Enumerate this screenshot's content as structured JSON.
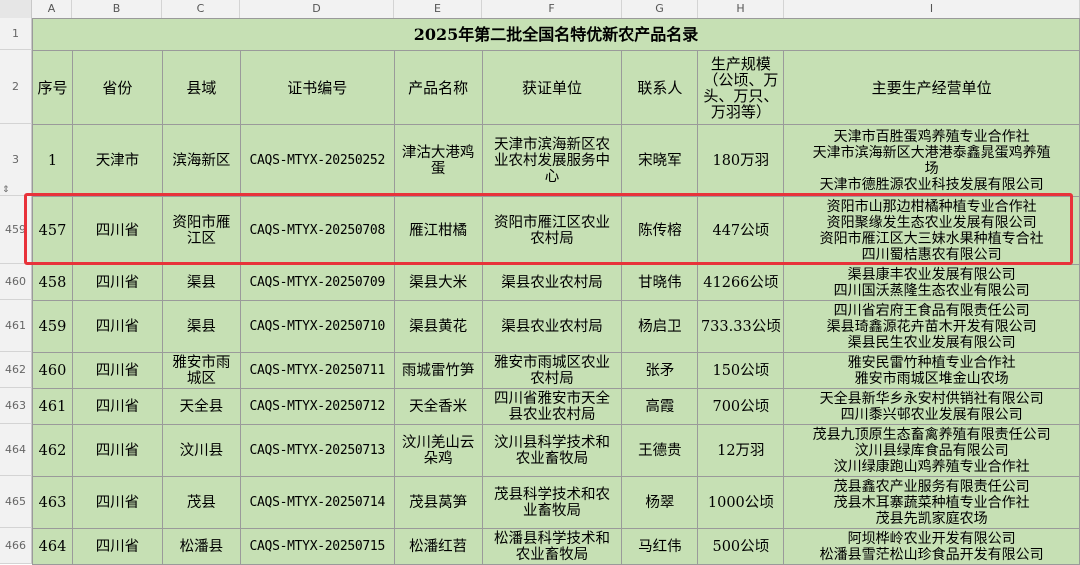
{
  "column_letters": [
    "A",
    "B",
    "C",
    "D",
    "E",
    "F",
    "G",
    "H",
    "I"
  ],
  "title": "2025年第二批全国名特优新农产品名录",
  "headers": {
    "seq": "序号",
    "province": "省份",
    "county": "县域",
    "cert": "证书编号",
    "product": "产品名称",
    "unit": "获证单位",
    "contact": "联系人",
    "scale_lines": [
      "生产规模",
      "（公顷、万",
      "头、万只、",
      "万羽等）"
    ],
    "producers": "主要生产经营单位"
  },
  "row_numbers": [
    "1",
    "2",
    "3",
    "459",
    "460",
    "461",
    "462",
    "463",
    "464",
    "465",
    "466"
  ],
  "rows": [
    {
      "seq": "1",
      "province": "天津市",
      "county_lines": [
        "滨海新区"
      ],
      "cert": "CAQS-MTYX-20250252",
      "product_lines": [
        "津沽大港鸡",
        "蛋"
      ],
      "unit_lines": [
        "天津市滨海新区农",
        "业农村发展服务中",
        "心"
      ],
      "contact": "宋晓军",
      "scale": "180万羽",
      "producers": [
        "天津市百胜蛋鸡养殖专业合作社",
        "天津市滨海新区大港港泰鑫晁蛋鸡养殖",
        "场",
        "天津市德胜源农业科技发展有限公司"
      ]
    },
    {
      "seq": "457",
      "province": "四川省",
      "county_lines": [
        "资阳市雁",
        "江区"
      ],
      "cert": "CAQS-MTYX-20250708",
      "product_lines": [
        "雁江柑橘"
      ],
      "unit_lines": [
        "资阳市雁江区农业",
        "农村局"
      ],
      "contact": "陈传榕",
      "scale": "447公顷",
      "producers": [
        "资阳市山那边柑橘种植专业合作社",
        "资阳聚缘发生态农业发展有限公司",
        "资阳市雁江区大三妹水果种植专合社",
        "四川蜀桔惠农有限公司"
      ]
    },
    {
      "seq": "458",
      "province": "四川省",
      "county_lines": [
        "渠县"
      ],
      "cert": "CAQS-MTYX-20250709",
      "product_lines": [
        "渠县大米"
      ],
      "unit_lines": [
        "渠县农业农村局"
      ],
      "contact": "甘晓伟",
      "scale": "41266公顷",
      "producers": [
        "渠县康丰农业发展有限公司",
        "四川国沃蒸隆生态农业有限公司"
      ]
    },
    {
      "seq": "459",
      "province": "四川省",
      "county_lines": [
        "渠县"
      ],
      "cert": "CAQS-MTYX-20250710",
      "product_lines": [
        "渠县黄花"
      ],
      "unit_lines": [
        "渠县农业农村局"
      ],
      "contact": "杨启卫",
      "scale": "733.33公顷",
      "producers": [
        "四川省宕府王食品有限责任公司",
        "渠县琦鑫源花卉苗木开发有限公司",
        "渠县民生农业发展有限公司"
      ]
    },
    {
      "seq": "460",
      "province": "四川省",
      "county_lines": [
        "雅安市雨",
        "城区"
      ],
      "cert": "CAQS-MTYX-20250711",
      "product_lines": [
        "雨城雷竹笋"
      ],
      "unit_lines": [
        "雅安市雨城区农业",
        "农村局"
      ],
      "contact": "张矛",
      "scale": "150公顷",
      "producers": [
        "雅安民雷竹种植专业合作社",
        "雅安市雨城区堆金山农场"
      ]
    },
    {
      "seq": "461",
      "province": "四川省",
      "county_lines": [
        "天全县"
      ],
      "cert": "CAQS-MTYX-20250712",
      "product_lines": [
        "天全香米"
      ],
      "unit_lines": [
        "四川省雅安市天全",
        "县农业农村局"
      ],
      "contact": "高霞",
      "scale": "700公顷",
      "producers": [
        "天全县新华乡永安村供销社有限公司",
        "四川黍兴邨农业发展有限公司"
      ]
    },
    {
      "seq": "462",
      "province": "四川省",
      "county_lines": [
        "汶川县"
      ],
      "cert": "CAQS-MTYX-20250713",
      "product_lines": [
        "汶川羌山云",
        "朵鸡"
      ],
      "unit_lines": [
        "汶川县科学技术和",
        "农业畜牧局"
      ],
      "contact": "王德贵",
      "scale": "12万羽",
      "producers": [
        "茂县九顶原生态畜禽养殖有限责任公司",
        "汶川县绿库食品有限公司",
        "汶川绿康跑山鸡养殖专业合作社"
      ]
    },
    {
      "seq": "463",
      "province": "四川省",
      "county_lines": [
        "茂县"
      ],
      "cert": "CAQS-MTYX-20250714",
      "product_lines": [
        "茂县莴笋"
      ],
      "unit_lines": [
        "茂县科学技术和农",
        "业畜牧局"
      ],
      "contact": "杨翠",
      "scale": "1000公顷",
      "producers": [
        "茂县鑫农产业服务有限责任公司",
        "茂县木耳寨蔬菜种植专业合作社",
        "茂县先凯家庭农场"
      ]
    },
    {
      "seq": "464",
      "province": "四川省",
      "county_lines": [
        "松潘县"
      ],
      "cert": "CAQS-MTYX-20250715",
      "product_lines": [
        "松潘红苕"
      ],
      "unit_lines": [
        "松潘县科学技术和",
        "农业畜牧局"
      ],
      "contact": "马红伟",
      "scale": "500公顷",
      "producers": [
        "阿坝桦岭农业开发有限公司",
        "松潘县雪茫松山珍食品开发有限公司"
      ]
    }
  ],
  "colors": {
    "cell_fill": "#c6e0b4",
    "grid": "#9a9a9a",
    "highlight_border": "#e8323a"
  }
}
